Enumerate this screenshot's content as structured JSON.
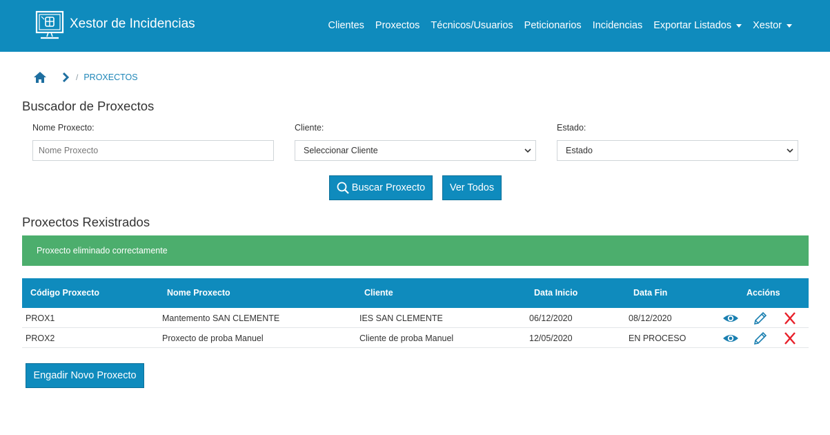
{
  "app": {
    "title": "Xestor de Incidencias"
  },
  "nav": {
    "items": [
      {
        "label": "Clientes"
      },
      {
        "label": "Proxectos"
      },
      {
        "label": "Técnicos/Usuarios"
      },
      {
        "label": "Peticionarios"
      },
      {
        "label": "Incidencias"
      },
      {
        "label": "Exportar Listados"
      },
      {
        "label": "Xestor"
      }
    ]
  },
  "breadcrumb": {
    "separator": "/",
    "current": "PROXECTOS"
  },
  "search": {
    "title": "Buscador de Proxectos",
    "name_label": "Nome Proxecto:",
    "name_placeholder": "Nome Proxecto",
    "client_label": "Cliente:",
    "client_value": "Seleccionar Cliente",
    "state_label": "Estado:",
    "state_value": "Estado",
    "search_button": "Buscar Proxecto",
    "all_button": "Ver Todos"
  },
  "projects": {
    "title": "Proxectos Rexistrados",
    "alert": "Proxecto eliminado correctamente",
    "columns": [
      "Código Proxecto",
      "Nome Proxecto",
      "Cliente",
      "Data Inicio",
      "Data Fin",
      "Accións"
    ],
    "rows": [
      {
        "code": "PROX1",
        "name": "Mantemento SAN CLEMENTE",
        "client": "IES SAN CLEMENTE",
        "start": "06/12/2020",
        "end": "08/12/2020"
      },
      {
        "code": "PROX2",
        "name": "Proxecto de proba Manuel",
        "client": "Cliente de proba Manuel",
        "start": "12/05/2020",
        "end": "EN PROCESO"
      }
    ],
    "add_button": "Engadir Novo Proxecto"
  },
  "colors": {
    "primary": "#0f8bbd",
    "success": "#4cae6d",
    "danger": "#e8202a"
  },
  "icons": {
    "logo": "monitor-logo-icon",
    "home": "home-icon",
    "chevron": "chevron-right-icon",
    "search": "search-icon",
    "view": "eye-icon",
    "edit": "pencil-icon",
    "delete": "close-icon"
  }
}
